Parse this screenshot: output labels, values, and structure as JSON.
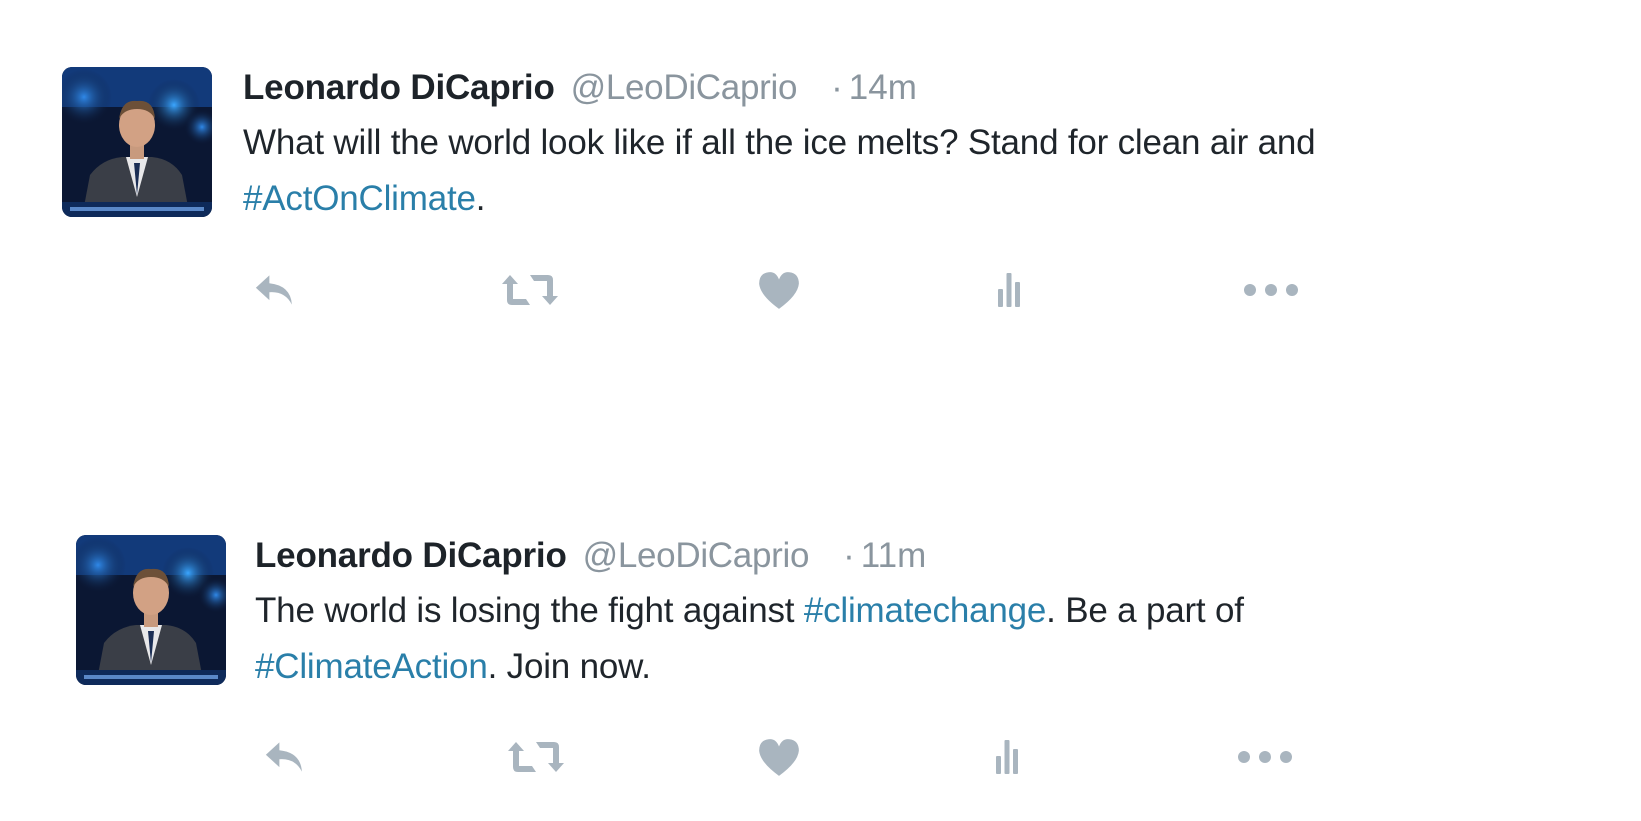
{
  "colors": {
    "name": "#1d2329",
    "muted": "#8a959e",
    "hashtag": "#2a7fa9",
    "action_icon": "#a9b5bf"
  },
  "tweets": [
    {
      "author": {
        "name": "Leonardo DiCaprio",
        "handle": "@LeoDiCaprio",
        "avatar_icon": "avatar-image"
      },
      "separator": "·",
      "time": "14m",
      "text": {
        "line1": "What will the world look like if all the ice melts? Stand for clean air and",
        "hashtag1": "#ActOnClimate",
        "end": "."
      },
      "actions": [
        "reply-icon",
        "retweet-icon",
        "like-icon",
        "analytics-icon",
        "more-icon"
      ]
    },
    {
      "author": {
        "name": "Leonardo DiCaprio",
        "handle": "@LeoDiCaprio",
        "avatar_icon": "avatar-image"
      },
      "separator": "·",
      "time": "11m",
      "text": {
        "pre": "The world is losing the fight against ",
        "hashtag1": "#climatechange",
        "mid": ". Be a part of",
        "hashtag2": "#ClimateAction",
        "end": ". Join now."
      },
      "actions": [
        "reply-icon",
        "retweet-icon",
        "like-icon",
        "analytics-icon",
        "more-icon"
      ]
    }
  ]
}
